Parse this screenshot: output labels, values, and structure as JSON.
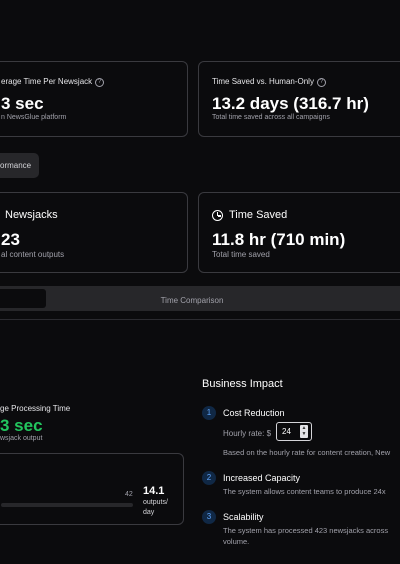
{
  "stats_top": {
    "avg": {
      "title": "erage Time Per Newsjack",
      "value": "3 sec",
      "sub": "n NewsGlue platform"
    },
    "saved": {
      "title": "Time Saved vs. Human-Only",
      "value": "13.2 days (316.7 hr)",
      "sub": "Total time saved across all campaigns"
    }
  },
  "tab_performance": "ormance",
  "stats_mid": {
    "newsjacks": {
      "title": "Newsjacks",
      "value": "23",
      "sub": "al content outputs"
    },
    "time_saved": {
      "title": "Time Saved",
      "value": "11.8 hr (710 min)",
      "sub": "Total time saved"
    }
  },
  "comparison_tabs": {
    "active": "",
    "comparison": "Time Comparison"
  },
  "processing": {
    "title": "ge Processing Time",
    "value": "3 sec",
    "sub": "wsjack output",
    "progress_max_label": "42",
    "throughput_value": "14.1",
    "throughput_unit_line1": "outputs/",
    "throughput_unit_line2": "day"
  },
  "business": {
    "title": "Business Impact",
    "items": [
      {
        "num": "1",
        "title": "Cost Reduction",
        "rate_label": "Hourly rate: $",
        "rate_value": "24",
        "desc": "Based on the hourly rate for content creation, New"
      },
      {
        "num": "2",
        "title": "Increased Capacity",
        "desc": "The system allows content teams to produce 24x"
      },
      {
        "num": "3",
        "title": "Scalability",
        "desc_line1": "The system has processed 423 newsjacks across",
        "desc_line2": "volume."
      }
    ]
  },
  "colors": {
    "accent_green": "#22c55e",
    "accent_blue": "#3b82f6",
    "background": "#0b0b0d",
    "border": "#3a3a3f"
  }
}
